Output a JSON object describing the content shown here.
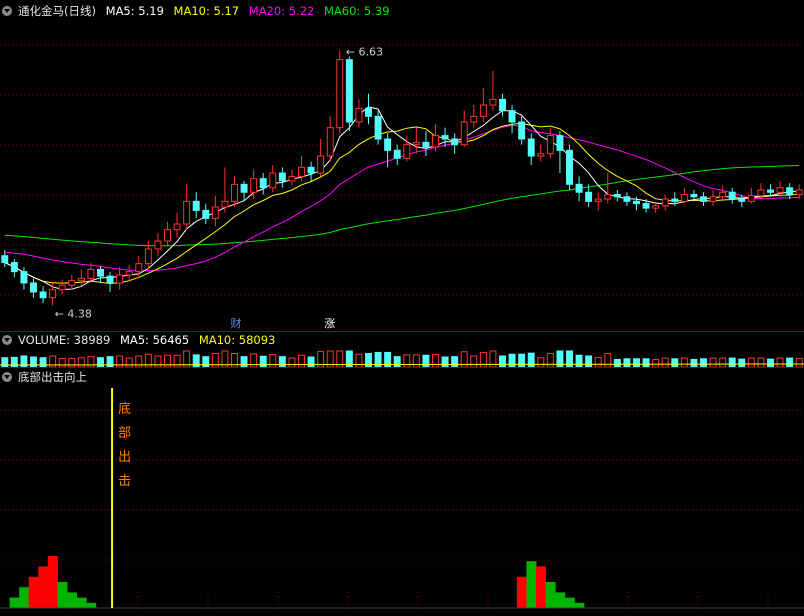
{
  "main_header": {
    "stock": "通化金马(日线)",
    "ma5": "MA5: 5.19",
    "ma10": "MA10: 5.17",
    "ma20": "MA20: 5.22",
    "ma60": "MA60: 5.39"
  },
  "volume_header": {
    "title": "VOLUME: 38989",
    "ma5": "MA5: 56465",
    "ma10": "MA10: 58093"
  },
  "indicator_header": {
    "title": "底部出击向上"
  },
  "annotations": {
    "high": "6.63",
    "low": "4.38",
    "tag_cai": "财",
    "tag_zhang": "涨",
    "signal_text": [
      "底",
      "部",
      "出",
      "击"
    ]
  },
  "colors": {
    "up": "#ff3232",
    "down": "#54fcfc",
    "ma5": "#ffffff",
    "ma10": "#ffff00",
    "ma20": "#ff00ff",
    "ma60": "#00e600",
    "grid": "#8b0000",
    "signal_line": "#ffff00",
    "signal_text": "#ff8000",
    "bar_red": "#ff0000",
    "bar_green": "#00b400"
  },
  "chart_data": [
    {
      "type": "candlestick",
      "title": "通化金马(日线)",
      "ylim": [
        4.2,
        6.9
      ],
      "high": 6.63,
      "low": 4.38,
      "series": [
        {
          "name": "MA5",
          "current": 5.19
        },
        {
          "name": "MA10",
          "current": 5.17
        },
        {
          "name": "MA20",
          "current": 5.22
        },
        {
          "name": "MA60",
          "current": 5.39
        }
      ],
      "candles": [
        [
          4.82,
          4.76,
          4.87,
          4.72
        ],
        [
          4.76,
          4.68,
          4.79,
          4.63
        ],
        [
          4.68,
          4.58,
          4.72,
          4.52
        ],
        [
          4.58,
          4.5,
          4.62,
          4.45
        ],
        [
          4.5,
          4.45,
          4.55,
          4.4
        ],
        [
          4.45,
          4.52,
          4.58,
          4.38
        ],
        [
          4.52,
          4.56,
          4.61,
          4.48
        ],
        [
          4.56,
          4.6,
          4.65,
          4.52
        ],
        [
          4.6,
          4.62,
          4.7,
          4.55
        ],
        [
          4.62,
          4.7,
          4.76,
          4.58
        ],
        [
          4.7,
          4.64,
          4.73,
          4.58
        ],
        [
          4.64,
          4.58,
          4.68,
          4.5
        ],
        [
          4.58,
          4.65,
          4.72,
          4.52
        ],
        [
          4.65,
          4.68,
          4.74,
          4.6
        ],
        [
          4.68,
          4.75,
          4.82,
          4.62
        ],
        [
          4.75,
          4.88,
          4.95,
          4.7
        ],
        [
          4.88,
          4.95,
          5.02,
          4.82
        ],
        [
          4.95,
          5.05,
          5.12,
          4.9
        ],
        [
          5.05,
          5.1,
          5.2,
          4.98
        ],
        [
          5.1,
          5.3,
          5.45,
          5.05
        ],
        [
          5.3,
          5.22,
          5.38,
          5.15
        ],
        [
          5.22,
          5.15,
          5.28,
          5.1
        ],
        [
          5.15,
          5.25,
          5.35,
          5.08
        ],
        [
          5.25,
          5.3,
          5.6,
          5.2
        ],
        [
          5.3,
          5.45,
          5.52,
          5.25
        ],
        [
          5.45,
          5.38,
          5.48,
          5.3
        ],
        [
          5.38,
          5.5,
          5.58,
          5.32
        ],
        [
          5.5,
          5.42,
          5.55,
          5.36
        ],
        [
          5.42,
          5.55,
          5.62,
          5.38
        ],
        [
          5.55,
          5.48,
          5.6,
          5.42
        ],
        [
          5.48,
          5.52,
          5.58,
          5.44
        ],
        [
          5.52,
          5.6,
          5.7,
          5.48
        ],
        [
          5.6,
          5.55,
          5.65,
          5.48
        ],
        [
          5.55,
          5.7,
          5.85,
          5.52
        ],
        [
          5.7,
          5.95,
          6.05,
          5.65
        ],
        [
          5.95,
          6.55,
          6.63,
          5.9
        ],
        [
          6.55,
          6.0,
          6.58,
          5.92
        ],
        [
          6.0,
          6.12,
          6.2,
          5.95
        ],
        [
          6.12,
          6.05,
          6.25,
          5.98
        ],
        [
          6.05,
          5.85,
          6.1,
          5.8
        ],
        [
          5.85,
          5.75,
          5.9,
          5.6
        ],
        [
          5.75,
          5.68,
          5.8,
          5.62
        ],
        [
          5.68,
          5.8,
          5.88,
          5.65
        ],
        [
          5.8,
          5.82,
          5.95,
          5.72
        ],
        [
          5.82,
          5.78,
          5.92,
          5.7
        ],
        [
          5.78,
          5.88,
          5.98,
          5.74
        ],
        [
          5.88,
          5.85,
          5.95,
          5.78
        ],
        [
          5.85,
          5.8,
          5.9,
          5.72
        ],
        [
          5.8,
          6.0,
          6.1,
          5.78
        ],
        [
          6.0,
          6.05,
          6.15,
          5.95
        ],
        [
          6.05,
          6.15,
          6.3,
          6.0
        ],
        [
          6.15,
          6.2,
          6.45,
          6.1
        ],
        [
          6.2,
          6.1,
          6.25,
          6.05
        ],
        [
          6.1,
          6.0,
          6.15,
          5.9
        ],
        [
          6.0,
          5.85,
          6.05,
          5.8
        ],
        [
          5.85,
          5.7,
          5.9,
          5.62
        ],
        [
          5.7,
          5.72,
          5.8,
          5.65
        ],
        [
          5.72,
          5.88,
          5.95,
          5.68
        ],
        [
          5.88,
          5.75,
          5.92,
          5.55
        ],
        [
          5.75,
          5.45,
          5.8,
          5.4
        ],
        [
          5.45,
          5.38,
          5.52,
          5.3
        ],
        [
          5.38,
          5.3,
          5.45,
          5.25
        ],
        [
          5.3,
          5.32,
          5.38,
          5.22
        ],
        [
          5.32,
          5.36,
          5.55,
          5.28
        ],
        [
          5.36,
          5.34,
          5.4,
          5.3
        ],
        [
          5.34,
          5.3,
          5.38,
          5.26
        ],
        [
          5.3,
          5.28,
          5.34,
          5.22
        ],
        [
          5.28,
          5.24,
          5.32,
          5.2
        ],
        [
          5.24,
          5.26,
          5.3,
          5.2
        ],
        [
          5.26,
          5.32,
          5.36,
          5.22
        ],
        [
          5.32,
          5.3,
          5.38,
          5.26
        ],
        [
          5.3,
          5.36,
          5.42,
          5.28
        ],
        [
          5.36,
          5.34,
          5.4,
          5.3
        ],
        [
          5.34,
          5.3,
          5.38,
          5.26
        ],
        [
          5.3,
          5.34,
          5.4,
          5.26
        ],
        [
          5.34,
          5.38,
          5.44,
          5.3
        ],
        [
          5.38,
          5.32,
          5.42,
          5.28
        ],
        [
          5.32,
          5.3,
          5.36,
          5.25
        ],
        [
          5.3,
          5.35,
          5.42,
          5.28
        ],
        [
          5.35,
          5.4,
          5.46,
          5.32
        ],
        [
          5.4,
          5.38,
          5.45,
          5.34
        ],
        [
          5.38,
          5.42,
          5.48,
          5.34
        ],
        [
          5.42,
          5.36,
          5.46,
          5.32
        ],
        [
          5.36,
          5.4,
          5.45,
          5.32
        ]
      ]
    },
    {
      "type": "bar",
      "title": "VOLUME: 38989",
      "series": [
        {
          "name": "VOLUME",
          "current": 38989
        },
        {
          "name": "MA5",
          "current": 56465
        },
        {
          "name": "MA10",
          "current": 58093
        }
      ]
    },
    {
      "type": "bar",
      "title": "底部出击向上",
      "signal_index": 11,
      "values": [
        0,
        2,
        4,
        6,
        8,
        10,
        5,
        3,
        2,
        1,
        0,
        0,
        0,
        0,
        0,
        0,
        0,
        0,
        0,
        0,
        0,
        0,
        0,
        0,
        0,
        0,
        0,
        0,
        0,
        0,
        0,
        0,
        0,
        0,
        0,
        0,
        0,
        0,
        0,
        0,
        0,
        0,
        0,
        0,
        0,
        0,
        0,
        0,
        0,
        0,
        0,
        0,
        0,
        0,
        6,
        9,
        8,
        5,
        3,
        2,
        1,
        0,
        0,
        0,
        0,
        0,
        0,
        0,
        0,
        0,
        0,
        0,
        0,
        0,
        0,
        0,
        0,
        0,
        0,
        0,
        0,
        0,
        0,
        0
      ]
    }
  ]
}
